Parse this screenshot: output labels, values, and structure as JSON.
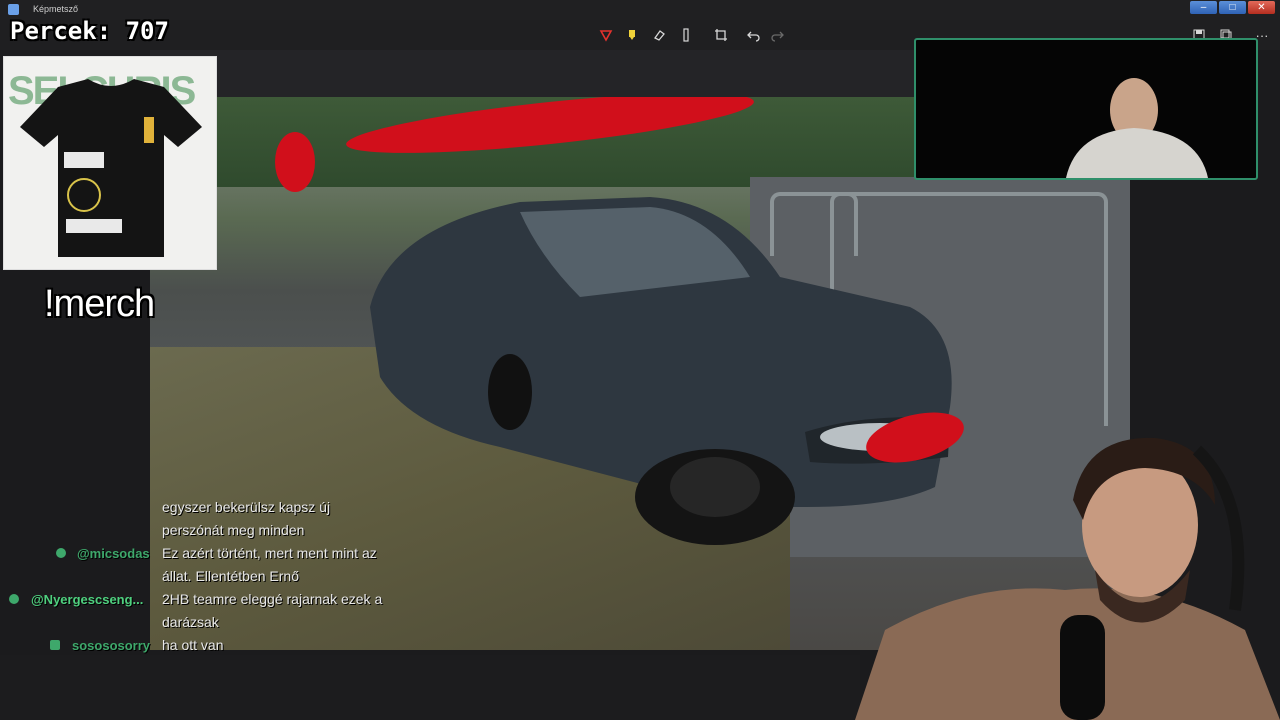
{
  "window": {
    "title": "Képmetsző",
    "minimize_label": "–",
    "maximize_label": "□",
    "close_label": "✕"
  },
  "overlay": {
    "percek_counter": "Percek: 707",
    "merch_command": "!merch",
    "merch_image_text": "SELCHRIS"
  },
  "toolbar": {
    "tools": [
      "ballpoint-pen",
      "highlighter",
      "eraser",
      "ruler",
      "crop",
      "undo",
      "redo"
    ],
    "right_tools": [
      "save",
      "copy",
      "more"
    ],
    "more_label": "···"
  },
  "chat": {
    "messages": [
      {
        "user": "",
        "text": "egyszer bekerülsz kapsz új"
      },
      {
        "user": "",
        "text": "perszónát meg minden"
      },
      {
        "user": "@micsodas",
        "text": "Ez azért történt, mert ment mint az"
      },
      {
        "user": "",
        "text": "állat. Ellentétben Ernő"
      },
      {
        "user": "@Nyergescseng...",
        "text": "2HB teamre eleggé rajarnak ezek a"
      },
      {
        "user": "",
        "text": "darázsak"
      },
      {
        "user": "sosososorry",
        "text": "ha ott van"
      }
    ]
  },
  "colors": {
    "accent_green": "#3ea86b",
    "redaction_red": "#d10f1b",
    "title_blue": "#2f63b6"
  }
}
